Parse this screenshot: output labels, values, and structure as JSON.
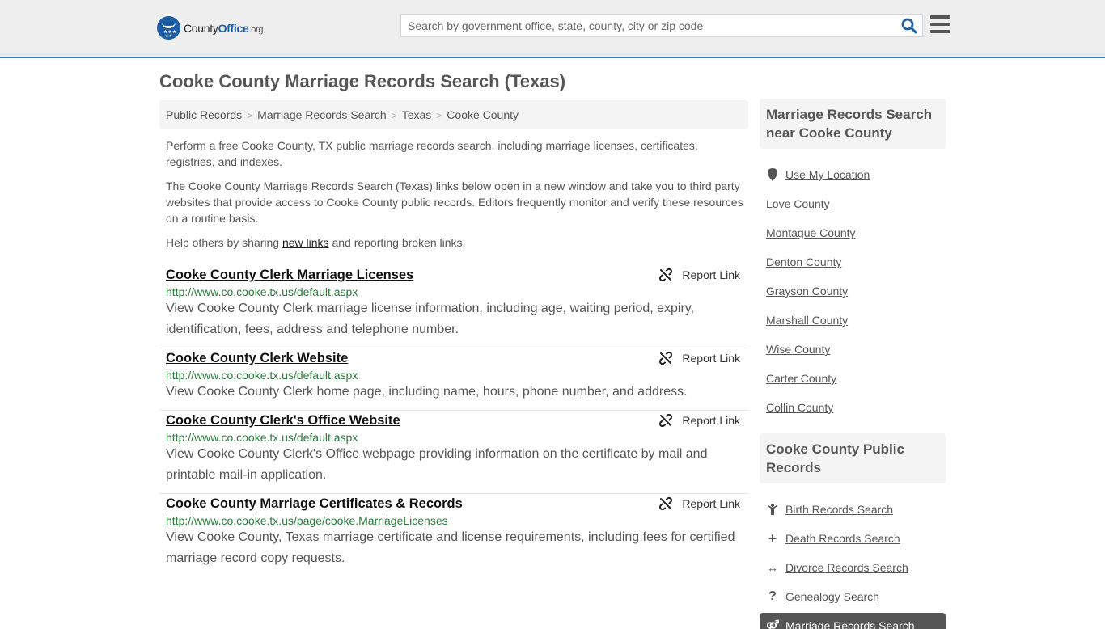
{
  "header": {
    "logo": {
      "name_part1": "County",
      "name_part2": "Office",
      "tld": ".org"
    },
    "search": {
      "placeholder": "Search by government office, state, county, city or zip code",
      "value": ""
    },
    "colors": {
      "brand": "#1c5da4",
      "header_border": "#3a7bb0"
    }
  },
  "page": {
    "title": "Cooke County Marriage Records Search (Texas)",
    "breadcrumb": [
      "Public Records",
      "Marriage Records Search",
      "Texas",
      "Cooke County"
    ],
    "intro": {
      "p1": "Perform a free Cooke County, TX public marriage records search, including marriage licenses, certificates, registries, and indexes.",
      "p2": "The Cooke County Marriage Records Search (Texas) links below open in a new window and take you to third party websites that provide access to Cooke County public records. Editors frequently monitor and verify these resources on a routine basis.",
      "p3_before": "Help others by sharing ",
      "p3_link": "new links",
      "p3_after": " and reporting broken links."
    }
  },
  "results": [
    {
      "title": "Cooke County Clerk Marriage Licenses",
      "url": "http://www.co.cooke.tx.us/default.aspx",
      "description": "View Cooke County Clerk marriage license information, including age, waiting period, expiry, identification, fees, address and telephone number.",
      "report_label": "Report Link"
    },
    {
      "title": "Cooke County Clerk Website",
      "url": "http://www.co.cooke.tx.us/default.aspx",
      "description": "View Cooke County Clerk home page, including name, hours, phone number, and address.",
      "report_label": "Report Link"
    },
    {
      "title": "Cooke County Clerk's Office Website",
      "url": "http://www.co.cooke.tx.us/default.aspx",
      "description": "View Cooke County Clerk's Office webpage providing information on the certificate by mail and printable mail-in application.",
      "report_label": "Report Link"
    },
    {
      "title": "Cooke County Marriage Certificates & Records",
      "url": "http://www.co.cooke.tx.us/page/cooke.MarriageLicenses",
      "description": "View Cooke County, Texas marriage certificate and license requirements, including fees for certified marriage record copy requests.",
      "report_label": "Report Link"
    }
  ],
  "sidebar": {
    "nearby": {
      "heading": "Marriage Records Search near Cooke County",
      "use_location": "Use My Location",
      "counties": [
        "Love County",
        "Montague County",
        "Denton County",
        "Grayson County",
        "Marshall County",
        "Wise County",
        "Carter County",
        "Collin County"
      ]
    },
    "public_records": {
      "heading": "Cooke County Public Records",
      "items": [
        {
          "label": "Birth Records Search",
          "icon": "child-icon"
        },
        {
          "label": "Death Records Search",
          "icon": "plus-icon"
        },
        {
          "label": "Divorce Records Search",
          "icon": "arrows-horizontal-icon"
        },
        {
          "label": "Genealogy Search",
          "icon": "question-icon"
        }
      ],
      "active_item": {
        "label": "Marriage Records Search",
        "icon": "marriage-icon"
      }
    }
  }
}
